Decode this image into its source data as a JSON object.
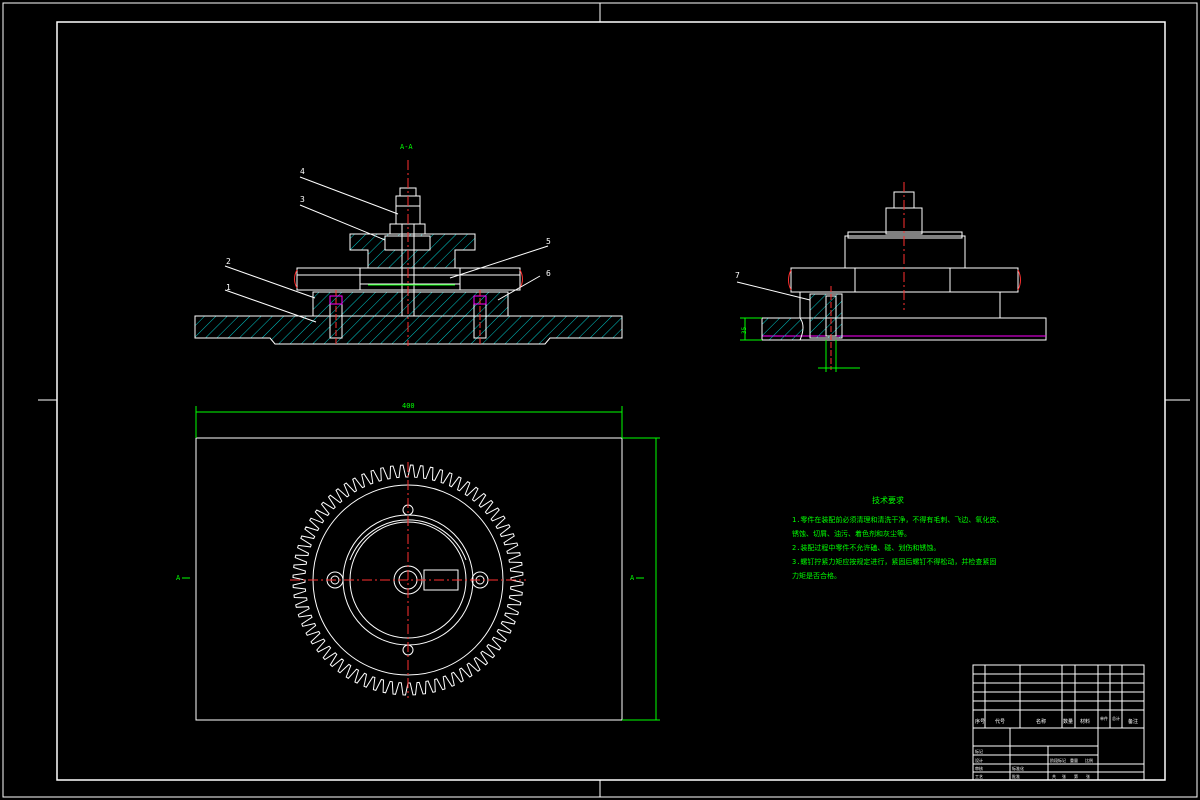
{
  "section_label": "A-A",
  "view_markers": {
    "left": "A",
    "right": "A"
  },
  "part_numbers": [
    "1",
    "2",
    "3",
    "4",
    "5",
    "6",
    "7"
  ],
  "dimensions": {
    "width": "400",
    "height": "",
    "side_height": "35",
    "bore": "",
    "hole_fit": "",
    "pin_fit_left": "",
    "pin_fit_right": ""
  },
  "tech_requirements": {
    "title": "技术要求",
    "lines": [
      "1.零件在装配前必须清理和清洗干净，不得有毛刺、飞边、氧化皮、",
      "锈蚀、切屑、油污、着色剂和灰尘等。",
      "2.装配过程中零件不允许磕、碰、划伤和锈蚀。",
      "3.螺钉拧紧力矩应按规定进行，紧固后螺钉不得松动，并检查紧固",
      "力矩是否合格。"
    ]
  },
  "title_block": {
    "col_headers": [
      "序号",
      "代号",
      "名称",
      "数量",
      "材料",
      "单件",
      "总计",
      "备注"
    ],
    "sign_labels": [
      "标记",
      "处数",
      "分区",
      "更改文件号",
      "签名",
      "年月日",
      "设计",
      "审核",
      "工艺",
      "标准化",
      "批准"
    ],
    "stage_labels": [
      "阶段标记",
      "重量",
      "比例"
    ],
    "sheet_labels": [
      "共",
      "张",
      "第",
      "张"
    ]
  },
  "colors": {
    "border": "#ffffff",
    "outline": "#ffffff",
    "hatch": "#00c8c8",
    "dimension": "#00ff00",
    "center": "#ff3030",
    "highlight": "#ff00ff",
    "text": "#00ff00"
  }
}
